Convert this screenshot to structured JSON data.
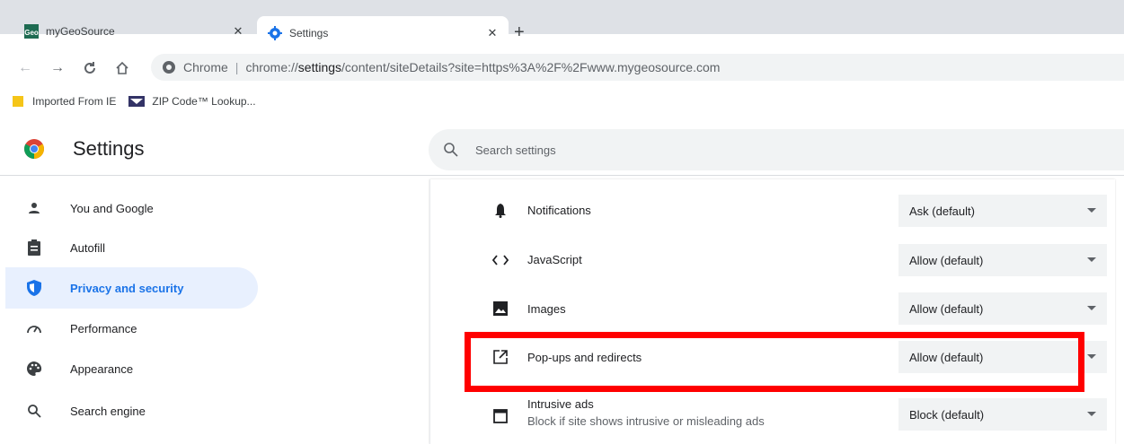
{
  "tabs": [
    {
      "title": "myGeoSource",
      "favicon": "geo-favicon",
      "active": false
    },
    {
      "title": "Settings",
      "favicon": "gear-favicon",
      "active": true
    }
  ],
  "toolbar": {
    "omnibox_label": "Chrome",
    "url_scheme": "chrome://",
    "url_host": "settings",
    "url_path": "/content/siteDetails?site=https%3A%2F%2Fwww.mygeosource.com"
  },
  "bookmarks": [
    {
      "label": "Imported From IE",
      "icon": "folder-icon"
    },
    {
      "label": "ZIP Code™ Lookup...",
      "icon": "usps-icon"
    }
  ],
  "header": {
    "title": "Settings",
    "search_placeholder": "Search settings"
  },
  "sidebar": {
    "items": [
      {
        "label": "You and Google",
        "icon": "person-icon"
      },
      {
        "label": "Autofill",
        "icon": "clipboard-icon"
      },
      {
        "label": "Privacy and security",
        "icon": "shield-icon",
        "selected": true
      },
      {
        "label": "Performance",
        "icon": "speedometer-icon"
      },
      {
        "label": "Appearance",
        "icon": "palette-icon"
      },
      {
        "label": "Search engine",
        "icon": "search-icon"
      }
    ]
  },
  "permissions": [
    {
      "label": "Notifications",
      "value": "Ask (default)",
      "icon": "bell-icon"
    },
    {
      "label": "JavaScript",
      "value": "Allow (default)",
      "icon": "code-icon"
    },
    {
      "label": "Images",
      "value": "Allow (default)",
      "icon": "image-icon"
    },
    {
      "label": "Pop-ups and redirects",
      "value": "Allow (default)",
      "icon": "open-external-icon"
    },
    {
      "label": "Intrusive ads",
      "sublabel": "Block if site shows intrusive or misleading ads",
      "value": "Block (default)",
      "icon": "window-icon"
    }
  ],
  "colors": {
    "accent": "#1a73e8",
    "selected_bg": "#e8f0fe",
    "highlight": "#ff0000"
  }
}
